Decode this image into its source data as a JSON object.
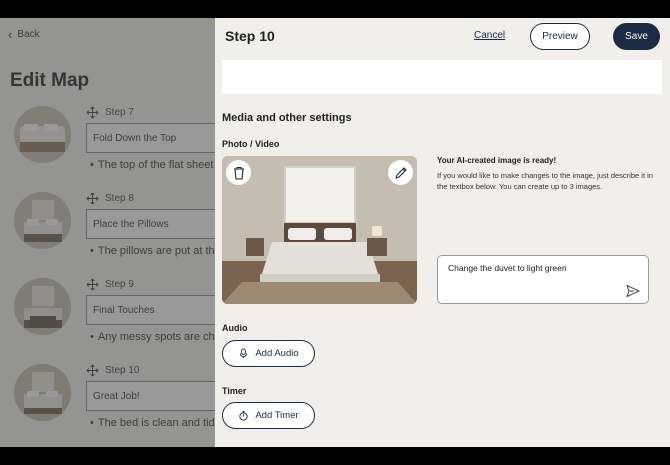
{
  "left": {
    "back_label": "Back",
    "page_title": "Edit Map",
    "steps": [
      {
        "label": "Step 7",
        "title": "Fold Down the Top",
        "description": "The top of the flat sheet"
      },
      {
        "label": "Step 8",
        "title": "Place the Pillows",
        "description": "The pillows are put at th"
      },
      {
        "label": "Step 9",
        "title": "Final Touches",
        "description": "Any messy spots are ch"
      },
      {
        "label": "Step 10",
        "title": "Great Job!",
        "description": "The bed is clean and tid"
      }
    ]
  },
  "panel": {
    "title": "Step 10",
    "cancel_label": "Cancel",
    "preview_label": "Preview",
    "save_label": "Save",
    "section_title": "Media and other settings",
    "photo_label": "Photo / Video",
    "ai_title": "Your AI-created image is ready!",
    "ai_text": "If you would like to make changes to the image, just describe it in the textbox below. You can create up to 3 images.",
    "prompt_value": "Change the duvet to light green",
    "audio_label": "Audio",
    "add_audio_label": "Add Audio",
    "timer_label": "Timer",
    "add_timer_label": "Add Timer"
  },
  "icons": {
    "back": "chevron-left-icon",
    "drag": "move-arrows-icon",
    "delete": "trash-icon",
    "edit": "pencil-icon",
    "send": "send-icon",
    "audio": "microphone-icon",
    "timer": "stopwatch-icon"
  },
  "colors": {
    "accent": "#1d2a44",
    "panel_bg": "#f0efeb",
    "overlay": "rgba(70,70,70,0.55)"
  }
}
